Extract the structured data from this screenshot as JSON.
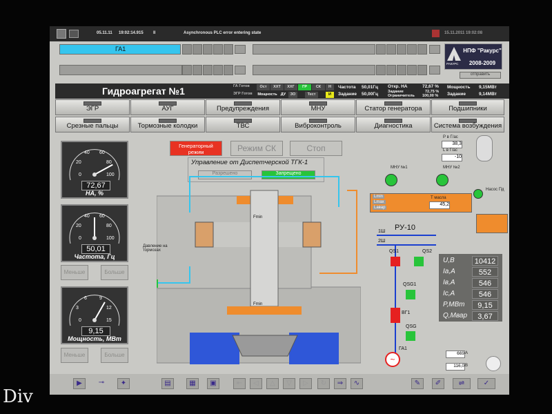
{
  "watermark": "Div",
  "topbar": {
    "date": "05.11.11",
    "time": "19:02:14.915",
    "flag": "II",
    "message": "Asynchronous PLC error entering state",
    "right_time": "15.11.2011 19:02:08"
  },
  "unit_field": "ГА1",
  "logo": {
    "company": "НПФ \"Ракурс\"",
    "years": "2008-2009",
    "brand": "РАКУРС"
  },
  "small_btn": "отправить",
  "title": "Гидроагрегат №1",
  "status_row1": {
    "ga": "ГА Готов",
    "tags": [
      "Ост",
      "ХХТ",
      "ХХГ",
      "ГР",
      "СК",
      "Н"
    ],
    "freq_label": "Частота",
    "freq_val": "50,01Гц",
    "na_label": "Откр. НА",
    "na_val": "72,67 %",
    "power_label": "Мощность",
    "power_val": "9,15МВт"
  },
  "status_row2": {
    "egr": "ЭГР Готов",
    "tags": [
      "Мощность",
      "ДУ",
      "ЗО",
      "Тест",
      "И"
    ],
    "task_label": "Задание",
    "task_val": "50,00Гц",
    "task2_label": "Задание",
    "task2_val": "72,75 %",
    "lim_label": "Ограничитель",
    "lim_val": "100,00 %",
    "task3_label": "Задание",
    "task3_val": "9,14МВт"
  },
  "buttons_row1": [
    "ЭГР",
    "АУГ",
    "Предупреждения",
    "МНУ",
    "Статор генератора",
    "Подшипники"
  ],
  "buttons_row2": [
    "Срезные пальцы",
    "Тормозные колодки",
    "ТВС",
    "Виброконтроль",
    "Диагностика",
    "Система возбуждения"
  ],
  "gauges": [
    {
      "value": "72,67",
      "unit": "НА, %",
      "ticks": [
        "0",
        "20",
        "40",
        "60",
        "80",
        "100"
      ],
      "fraction": 0.7267
    },
    {
      "value": "50,01",
      "unit": "Частота, Гц",
      "ticks": [
        "0",
        "20",
        "40",
        "60",
        "80",
        "100"
      ],
      "fraction": 0.5001
    },
    {
      "value": "9,15",
      "unit": "Мощность, МВт",
      "ticks": [
        "0",
        "3",
        "6",
        "9",
        "12",
        "15"
      ],
      "fraction": 0.61
    }
  ],
  "gauge_btns": {
    "less": "Меньше",
    "more": "Больше"
  },
  "modes": {
    "gen": "Генераторный режим",
    "sk": "Режим СК",
    "stop": "Стоп"
  },
  "control": {
    "title": "Управление от Диспетчерской ТГК-1",
    "allowed": "Разрешено",
    "forbidden": "Запрещено"
  },
  "labels": {
    "brake_pressure": "Давление на тормозах",
    "fmin": "Fmin",
    "fmin2": "Fmin"
  },
  "oil": {
    "p_gas": "Р в Г/ас",
    "p_val": "38,3",
    "l_gas": "L в Г/ас",
    "l_val": "-10",
    "t_oil": "Т масла",
    "t_val": "45,2",
    "pump1": "МНУ №1",
    "pump2": "МНУ №2",
    "pump3": "Насос Пд",
    "lmin": "Lmin",
    "lmax": "Lmax",
    "lavr": "Lавар"
  },
  "ru": {
    "title": "РУ-10",
    "bus1": "1Ш",
    "bus2": "2Ш",
    "qs1": "QS1",
    "qs2": "QS2",
    "qsg1": "QSG1",
    "vg1": "ВГ1",
    "qsg": "QSG",
    "ga1": "ГА1",
    "ia_val": "669",
    "ia_unit": "А",
    "uf_val": "116,0",
    "uf_unit": "В"
  },
  "elec": [
    {
      "label": "U,В",
      "value": "10412"
    },
    {
      "label": "Ia,A",
      "value": "552"
    },
    {
      "label": "Iв,A",
      "value": "546"
    },
    {
      "label": "Ic,A",
      "value": "546"
    },
    {
      "label": "P,МВт",
      "value": "9,15"
    },
    {
      "label": "Q,Мвар",
      "value": "3,67"
    }
  ],
  "colors": {
    "accent_green": "#28c43a",
    "alarm_red": "#e83222",
    "water_blue": "#2f57d8",
    "oil_orange": "#ef8c2d",
    "bus_blue": "#1a3fd0",
    "breaker_red": "#e62020"
  }
}
